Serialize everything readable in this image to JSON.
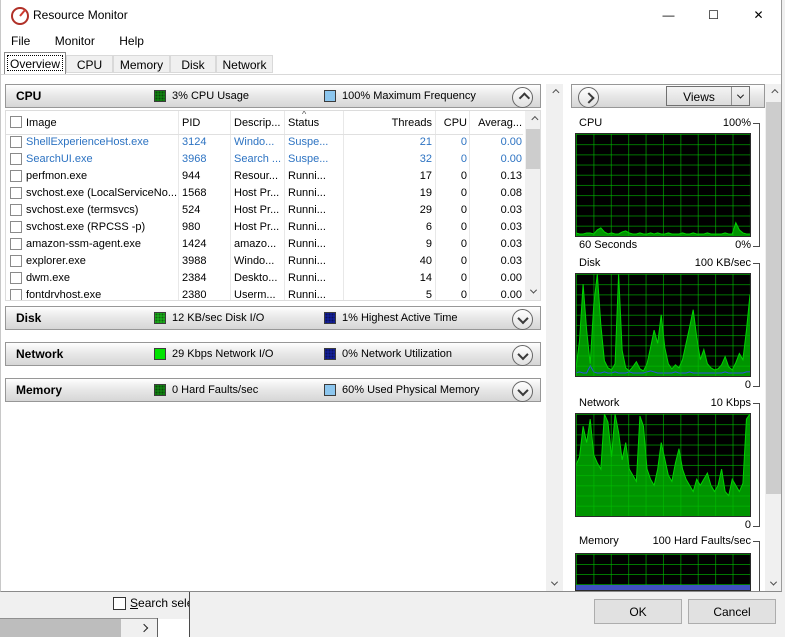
{
  "colors": {
    "suspended_text": "#2d73c2",
    "graph_bg": "#000000",
    "graph_grid_green": "#00be00",
    "cpu_line": "#00d400",
    "cpu_fill": "#009400",
    "disk_blue_line": "#2b50e0",
    "memory_used_bar": "#3f51c1",
    "cpu_usage_chip": "#128912",
    "max_freq_chip": "#8cc6ee",
    "disk_io_chip": "#1bb41b",
    "disk_active_chip": "#1420a0",
    "net_io_chip": "#00e400",
    "net_util_chip": "#1420a0",
    "hard_faults_chip": "#128912",
    "used_mem_chip": "#8cc6ee"
  },
  "window": {
    "title": "Resource Monitor",
    "controls": {
      "minimize": "—",
      "maximize": "☐",
      "close": "✕"
    }
  },
  "menu": {
    "items": [
      {
        "label": "File"
      },
      {
        "label": "Monitor"
      },
      {
        "label": "Help"
      }
    ]
  },
  "tabs": [
    {
      "label": "Overview",
      "active": true
    },
    {
      "label": "CPU"
    },
    {
      "label": "Memory"
    },
    {
      "label": "Disk"
    },
    {
      "label": "Network"
    }
  ],
  "cpu_section": {
    "title": "CPU",
    "usage_label": "3% CPU Usage",
    "freq_label": "100% Maximum Frequency"
  },
  "cpu_table": {
    "headers": {
      "image": "Image",
      "pid": "PID",
      "description": "Descrip...",
      "status": "Status",
      "threads": "Threads",
      "cpu": "CPU",
      "average": "Averag...",
      "sort_indicator": "^"
    },
    "rows": [
      {
        "image": "ShellExperienceHost.exe",
        "pid": "3124",
        "description": "Windo...",
        "status": "Suspe...",
        "threads": "21",
        "cpu": "0",
        "average": "0.00",
        "suspended": true
      },
      {
        "image": "SearchUI.exe",
        "pid": "3968",
        "description": "Search ...",
        "status": "Suspe...",
        "threads": "32",
        "cpu": "0",
        "average": "0.00",
        "suspended": true
      },
      {
        "image": "perfmon.exe",
        "pid": "944",
        "description": "Resour...",
        "status": "Runni...",
        "threads": "17",
        "cpu": "0",
        "average": "0.13"
      },
      {
        "image": "svchost.exe (LocalServiceNo...",
        "pid": "1568",
        "description": "Host Pr...",
        "status": "Runni...",
        "threads": "19",
        "cpu": "0",
        "average": "0.08"
      },
      {
        "image": "svchost.exe (termsvcs)",
        "pid": "524",
        "description": "Host Pr...",
        "status": "Runni...",
        "threads": "29",
        "cpu": "0",
        "average": "0.03"
      },
      {
        "image": "svchost.exe (RPCSS -p)",
        "pid": "980",
        "description": "Host Pr...",
        "status": "Runni...",
        "threads": "6",
        "cpu": "0",
        "average": "0.03"
      },
      {
        "image": "amazon-ssm-agent.exe",
        "pid": "1424",
        "description": "amazo...",
        "status": "Runni...",
        "threads": "9",
        "cpu": "0",
        "average": "0.03"
      },
      {
        "image": "explorer.exe",
        "pid": "3988",
        "description": "Windo...",
        "status": "Runni...",
        "threads": "40",
        "cpu": "0",
        "average": "0.03"
      },
      {
        "image": "dwm.exe",
        "pid": "2384",
        "description": "Deskto...",
        "status": "Runni...",
        "threads": "14",
        "cpu": "0",
        "average": "0.00"
      },
      {
        "image": "fontdrvhost.exe",
        "pid": "2380",
        "description": "Userm...",
        "status": "Runni...",
        "threads": "5",
        "cpu": "0",
        "average": "0.00",
        "clipped": true
      }
    ]
  },
  "disk_section": {
    "title": "Disk",
    "io_label": "12 KB/sec Disk I/O",
    "active_label": "1% Highest Active Time"
  },
  "network_section": {
    "title": "Network",
    "io_label": "29 Kbps Network I/O",
    "util_label": "0% Network Utilization"
  },
  "memory_section": {
    "title": "Memory",
    "faults_label": "0 Hard Faults/sec",
    "used_label": "60% Used Physical Memory"
  },
  "right_panel": {
    "views_label": "Views",
    "graphs": [
      {
        "name": "cpu",
        "title": "CPU",
        "scale_label": "100%",
        "bottom_left": "60 Seconds",
        "bottom_right": "0%",
        "series": [
          {
            "stroke": "#00d400",
            "fill": "#009400",
            "values": [
              3,
              2,
              2,
              3,
              3,
              2,
              6,
              8,
              4,
              2,
              3,
              2,
              2,
              4,
              5,
              3,
              2,
              2,
              3,
              2,
              2,
              3,
              2,
              3,
              2,
              2,
              3,
              2,
              2,
              2,
              3,
              2,
              2,
              3,
              2,
              2,
              2,
              3,
              2,
              2,
              2,
              2,
              3,
              2,
              2,
              13,
              6,
              3,
              2,
              2
            ]
          }
        ]
      },
      {
        "name": "disk",
        "title": "Disk",
        "scale_label": "100 KB/sec",
        "bottom_right": "0",
        "series": [
          {
            "stroke": "#00d400",
            "fill": "#009400",
            "values": [
              8,
              35,
              90,
              45,
              12,
              70,
              100,
              50,
              15,
              8,
              6,
              12,
              100,
              25,
              8,
              5,
              9,
              14,
              7,
              5,
              12,
              28,
              45,
              32,
              60,
              28,
              12,
              7,
              11,
              8,
              16,
              32,
              48,
              65,
              38,
              16,
              26,
              12,
              8,
              6,
              7,
              11,
              19,
              9,
              6,
              13,
              22,
              16,
              45,
              80
            ]
          },
          {
            "stroke": "#2b50e0",
            "values": [
              3,
              4,
              3,
              3,
              10,
              4,
              3,
              3,
              4,
              3,
              3,
              4,
              3,
              3,
              3,
              4,
              3,
              3,
              3,
              3,
              4,
              5,
              4,
              3,
              3,
              3,
              3,
              3,
              4,
              3,
              3,
              3,
              4,
              3,
              3,
              3,
              3,
              3,
              3,
              3,
              3,
              3,
              4,
              3,
              3,
              3,
              3,
              3,
              4,
              4
            ]
          }
        ]
      },
      {
        "name": "network",
        "title": "Network",
        "scale_label": "10 Kbps",
        "bottom_right": "0",
        "series": [
          {
            "stroke": "#00d400",
            "fill": "#009400",
            "values": [
              50,
              58,
              88,
              72,
              95,
              60,
              52,
              46,
              100,
              92,
              58,
              100,
              82,
              55,
              72,
              46,
              40,
              34,
              98,
              88,
              46,
              36,
              30,
              46,
              72,
              56,
              40,
              34,
              52,
              66,
              46,
              36,
              30,
              24,
              36,
              30,
              36,
              42,
              30,
              24,
              30,
              46,
              24,
              20,
              36,
              30,
              24,
              32,
              95,
              100
            ]
          }
        ]
      },
      {
        "name": "memory",
        "title": "Memory",
        "scale_label": "100 Hard Faults/sec",
        "series": [],
        "bottom_bar": {
          "color": "#3f51c1",
          "height": 5
        }
      }
    ]
  },
  "bottom": {
    "search_label": "Search sele",
    "ok_label": "OK",
    "cancel_label": "Cancel"
  }
}
